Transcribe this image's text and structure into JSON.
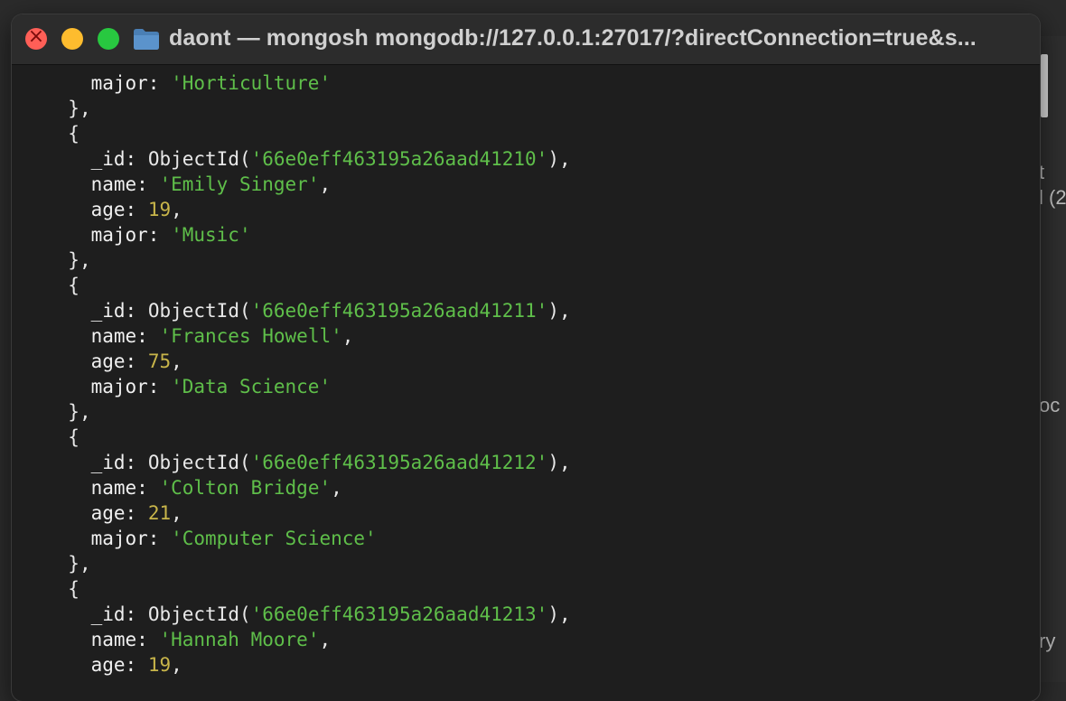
{
  "window": {
    "title": "daont — mongosh mongodb://127.0.0.1:27017/?directConnection=true&s...",
    "icon": "folder-icon"
  },
  "colors": {
    "string": "#5fbf4a",
    "number": "#c8b54a",
    "text": "#e8e8e8",
    "background": "#1e1e1e"
  },
  "background_window": {
    "fragments": [
      "t",
      "l (2",
      "oc",
      "ry"
    ]
  },
  "terminal": {
    "head": {
      "major_key": "major:",
      "major_value": "'Horticulture'",
      "close": "},"
    },
    "docs": [
      {
        "open": "{",
        "id_key": "_id:",
        "id_fn": "ObjectId(",
        "id_value": "'66e0eff463195a26aad41210'",
        "id_close": "),",
        "name_key": "name:",
        "name_value": "'Emily Singer'",
        "age_key": "age:",
        "age_value": "19",
        "major_key": "major:",
        "major_value": "'Music'",
        "close": "},"
      },
      {
        "open": "{",
        "id_key": "_id:",
        "id_fn": "ObjectId(",
        "id_value": "'66e0eff463195a26aad41211'",
        "id_close": "),",
        "name_key": "name:",
        "name_value": "'Frances Howell'",
        "age_key": "age:",
        "age_value": "75",
        "major_key": "major:",
        "major_value": "'Data Science'",
        "close": "},"
      },
      {
        "open": "{",
        "id_key": "_id:",
        "id_fn": "ObjectId(",
        "id_value": "'66e0eff463195a26aad41212'",
        "id_close": "),",
        "name_key": "name:",
        "name_value": "'Colton Bridge'",
        "age_key": "age:",
        "age_value": "21",
        "major_key": "major:",
        "major_value": "'Computer Science'",
        "close": "},"
      }
    ],
    "tail": {
      "open": "{",
      "id_key": "_id:",
      "id_fn": "ObjectId(",
      "id_value": "'66e0eff463195a26aad41213'",
      "id_close": "),",
      "name_key": "name:",
      "name_value": "'Hannah Moore'",
      "age_key": "age:",
      "age_value": "19"
    }
  }
}
